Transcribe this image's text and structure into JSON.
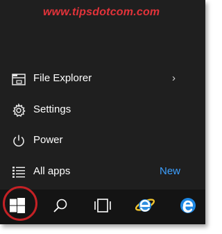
{
  "watermark": "www.tipsdotcom.com",
  "menu": {
    "file_explorer": {
      "label": "File Explorer",
      "icon": "file-explorer-icon",
      "chevron": "›"
    },
    "settings": {
      "label": "Settings",
      "icon": "gear-icon"
    },
    "power": {
      "label": "Power",
      "icon": "power-icon"
    },
    "all_apps": {
      "label": "All apps",
      "badge": "New",
      "icon": "list-icon"
    }
  },
  "taskbar": {
    "items": [
      "windows-start-icon",
      "search-icon",
      "task-view-icon",
      "internet-explorer-icon",
      "edge-icon"
    ]
  },
  "colors": {
    "menu_bg": "#1f1f1f",
    "taskbar_bg": "#141414",
    "accent": "#3da0ff",
    "highlight_circle": "#c42125",
    "watermark": "#e2333a"
  }
}
